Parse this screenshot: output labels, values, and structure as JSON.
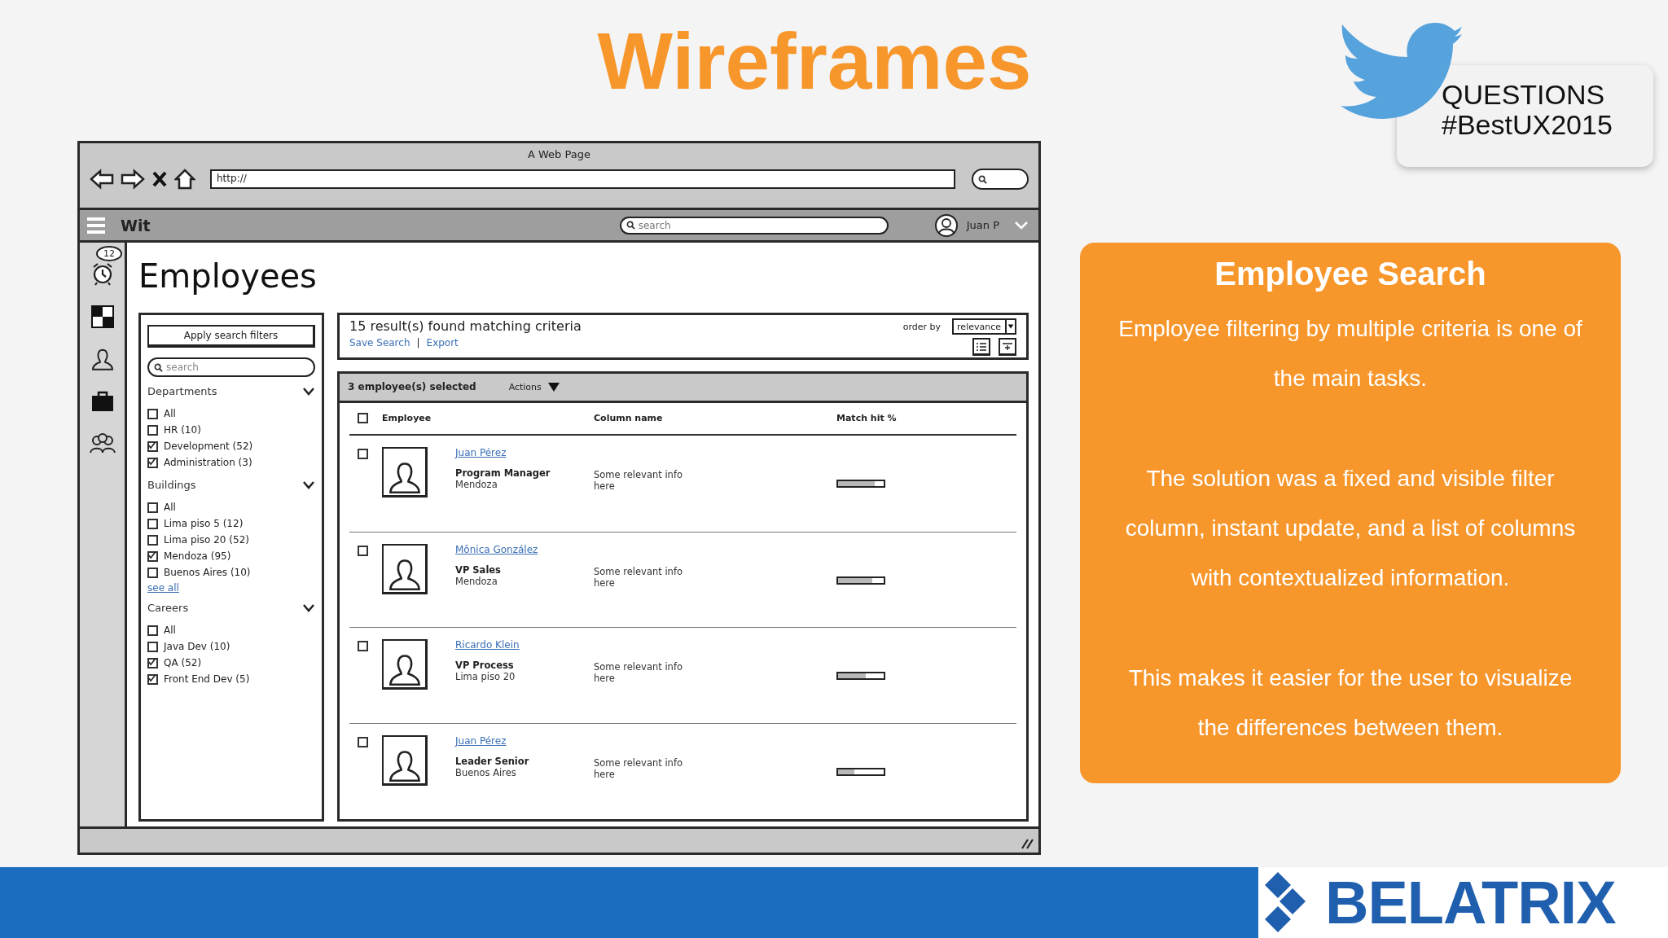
{
  "slide_title": "Wireframes",
  "questions_card": {
    "lines": [
      "QUESTIONS",
      "#BestUX2015"
    ]
  },
  "browser": {
    "title": "A Web Page",
    "url": "http://"
  },
  "app_bar": {
    "app_name": "Wit",
    "search_placeholder": "search",
    "user": "Juan P"
  },
  "side_rail": {
    "notification_count": "12"
  },
  "page_title": "Employees",
  "filters": {
    "apply_button": "Apply search filters",
    "search_placeholder": "search",
    "sections": [
      {
        "title": "Departments",
        "items": [
          {
            "label": "All",
            "checked": false
          },
          {
            "label": "HR (10)",
            "checked": false
          },
          {
            "label": "Development (52)",
            "checked": true
          },
          {
            "label": "Administration (3)",
            "checked": true
          }
        ]
      },
      {
        "title": "Buildings",
        "items": [
          {
            "label": "All",
            "checked": false
          },
          {
            "label": "Lima piso 5 (12)",
            "checked": false
          },
          {
            "label": "Lima piso 20 (52)",
            "checked": false
          },
          {
            "label": "Mendoza (95)",
            "checked": true
          },
          {
            "label": "Buenos Aires (10)",
            "checked": false
          }
        ],
        "link": "see all"
      },
      {
        "title": "Careers",
        "items": [
          {
            "label": "All",
            "checked": false
          },
          {
            "label": "Java Dev (10)",
            "checked": false
          },
          {
            "label": "QA (52)",
            "checked": true
          },
          {
            "label": "Front End Dev (5)",
            "checked": true
          }
        ]
      }
    ]
  },
  "results": {
    "summary": "15 result(s) found matching criteria",
    "links": [
      "Save Search",
      "Export"
    ],
    "link_separator": "|",
    "order_label": "order by",
    "order_value": "relevance"
  },
  "table": {
    "selection_summary": "3 employee(s) selected",
    "actions": "Actions",
    "header_checked": false,
    "columns": [
      "Employee",
      "Column name",
      "Match hit %"
    ],
    "rows": [
      {
        "name": "Juan Pérez",
        "role": "Program Manager",
        "location": "Mendoza",
        "info": "Some relevant info here",
        "checked": false,
        "level": 0.8
      },
      {
        "name": "Mônica González",
        "role": "VP Sales",
        "location": "Mendoza",
        "info": "Some relevant info here",
        "checked": false,
        "level": 0.75
      },
      {
        "name": "Ricardo Klein",
        "role": "VP Process",
        "location": "Lima piso 20",
        "info": "Some relevant info here",
        "checked": false,
        "level": 0.6
      },
      {
        "name": "Juan Pérez",
        "role": "Leader Senior",
        "location": "Buenos Aires",
        "info": "Some relevant info here",
        "checked": false,
        "level": 0.35
      }
    ]
  },
  "info_panel": {
    "title": "Employee Search",
    "paragraphs": [
      "Employee filtering by multiple criteria is one of the main tasks.",
      "The solution was a fixed and visible filter column, instant update, and a list of columns with contextualized information.",
      "This makes it easier for the user to visualize the differences between them."
    ]
  },
  "footer": {
    "brand": "BELATRIX"
  }
}
